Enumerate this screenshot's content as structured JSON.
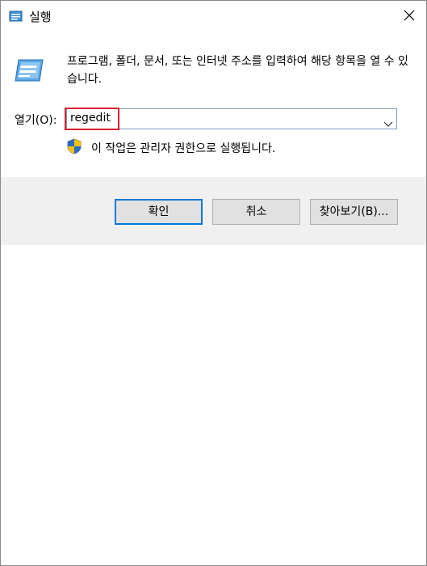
{
  "window": {
    "title": "실행",
    "close_symbol": "×"
  },
  "icons": {
    "app": "run-dialog-icon",
    "run": "run-dialog-icon",
    "shield": "uac-shield-icon",
    "combo_arrow": "chevron-down-icon",
    "close": "close-icon"
  },
  "main": {
    "description": "프로그램, 폴더, 문서, 또는 인터넷 주소를 입력하여 해당 항목을 열 수 있습니다.",
    "open_label": "열기(O):",
    "open_value": "regedit",
    "admin_note": "이 작업은 관리자 권한으로 실행됩니다."
  },
  "buttons": {
    "ok": "확인",
    "cancel": "취소",
    "browse": "찾아보기(B)..."
  },
  "colors": {
    "highlight_border": "#d9202f",
    "default_button_border": "#0078d7",
    "footer_bg": "#f0f0f0"
  }
}
